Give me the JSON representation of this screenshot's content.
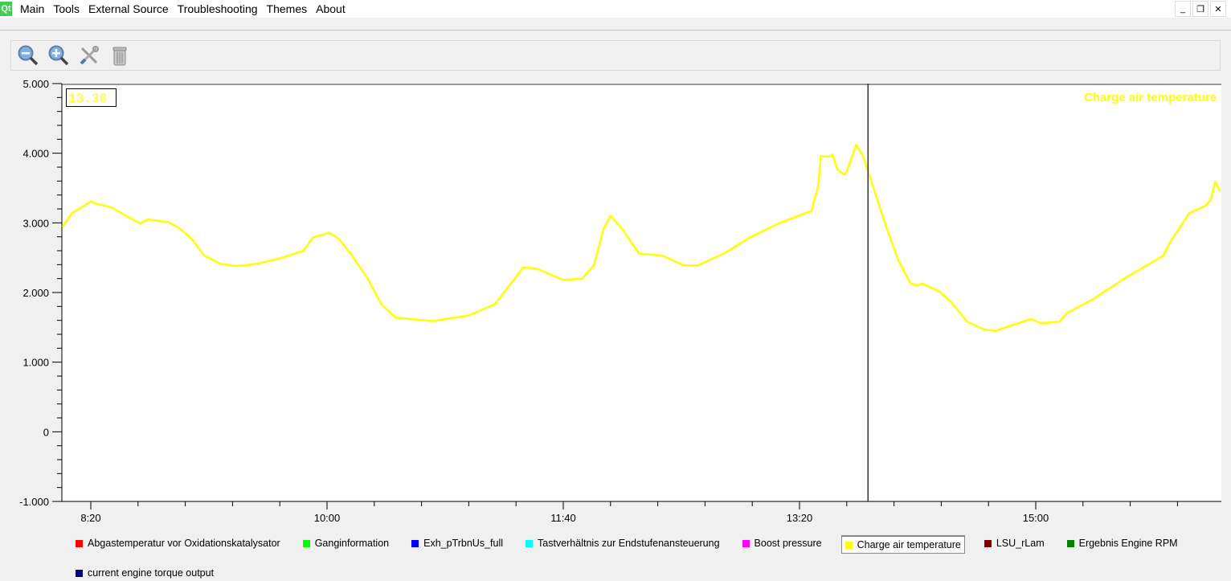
{
  "menu": {
    "items": [
      "Main",
      "Tools",
      "External Source",
      "Troubleshooting",
      "Themes",
      "About"
    ]
  },
  "toolbar": {
    "icons": [
      "zoom-out-icon",
      "zoom-in-icon",
      "settings-tools-icon",
      "trash-icon"
    ]
  },
  "readout": "13.36",
  "chart_data": {
    "type": "line",
    "title": "Charge air temperature",
    "title_color": "#ffff00",
    "ylim": [
      -1000,
      5000
    ],
    "yticks": [
      -1000,
      0,
      1000,
      2000,
      3000,
      4000,
      5000
    ],
    "ytick_labels": [
      "-1.000",
      "0",
      "1.000",
      "2.000",
      "3.000",
      "4.000",
      "5.000"
    ],
    "xlim": [
      "8:08",
      "16:19"
    ],
    "xticks": [
      "8:20",
      "10:00",
      "11:40",
      "13:20",
      "15:00"
    ],
    "cursor_x": "13:49",
    "grid": false,
    "legend_placement": "bottom",
    "series": [
      {
        "name": "Charge air temperature",
        "color": "#ffff00",
        "x": [
          "8:08",
          "8:12",
          "8:16",
          "8:20",
          "8:22",
          "8:29",
          "8:36",
          "8:41",
          "8:44",
          "8:53",
          "8:58",
          "9:03",
          "9:08",
          "9:15",
          "9:22",
          "9:30",
          "9:41",
          "9:50",
          "9:54",
          "10:01",
          "10:05",
          "10:10",
          "10:17",
          "10:23",
          "10:29",
          "10:35",
          "10:45",
          "10:52",
          "11:00",
          "11:11",
          "11:19",
          "11:23",
          "11:29",
          "11:40",
          "11:48",
          "11:53",
          "11:57",
          "12:00",
          "12:05",
          "12:12",
          "12:22",
          "12:31",
          "12:37",
          "12:48",
          "12:59",
          "13:11",
          "13:25",
          "13:28",
          "13:29",
          "13:32",
          "13:34",
          "13:36",
          "13:39",
          "13:40",
          "13:44",
          "13:47",
          "13:52",
          "13:57",
          "14:02",
          "14:07",
          "14:10",
          "14:12",
          "14:15",
          "14:19",
          "14:24",
          "14:31",
          "14:38",
          "14:43",
          "14:50",
          "14:58",
          "15:02",
          "15:10",
          "15:13",
          "15:24",
          "15:38",
          "15:54",
          "15:57",
          "16:05",
          "16:12",
          "16:14",
          "16:16",
          "16:18"
        ],
        "y": [
          2940,
          3140,
          3220,
          3310,
          3280,
          3220,
          3080,
          2990,
          3050,
          3010,
          2910,
          2760,
          2530,
          2410,
          2380,
          2410,
          2500,
          2600,
          2790,
          2860,
          2770,
          2560,
          2210,
          1830,
          1640,
          1620,
          1590,
          1630,
          1670,
          1830,
          2180,
          2360,
          2340,
          2180,
          2200,
          2390,
          2910,
          3100,
          2910,
          2560,
          2530,
          2390,
          2390,
          2560,
          2790,
          2990,
          3170,
          3540,
          3960,
          3950,
          3980,
          3770,
          3690,
          3740,
          4120,
          3950,
          3430,
          2910,
          2450,
          2130,
          2100,
          2130,
          2080,
          2020,
          1870,
          1580,
          1470,
          1450,
          1530,
          1620,
          1560,
          1580,
          1700,
          1900,
          2210,
          2530,
          2730,
          3140,
          3250,
          3330,
          3590,
          3450
        ]
      }
    ],
    "legend": [
      {
        "name": "Abgastemperatur vor Oxidationskatalysator",
        "color": "#ff0000"
      },
      {
        "name": "Ganginformation",
        "color": "#00ff00"
      },
      {
        "name": "Exh_pTrbnUs_full",
        "color": "#0000ff"
      },
      {
        "name": "Tastverhältnis zur Endstufenansteuerung",
        "color": "#00ffff"
      },
      {
        "name": "Boost pressure",
        "color": "#ff00ff"
      },
      {
        "name": "Charge air temperature",
        "color": "#ffff00",
        "active": true
      },
      {
        "name": "LSU_rLam",
        "color": "#800000"
      },
      {
        "name": "Ergebnis Engine RPM",
        "color": "#008000"
      },
      {
        "name": "current engine torque output",
        "color": "#000080"
      }
    ]
  }
}
